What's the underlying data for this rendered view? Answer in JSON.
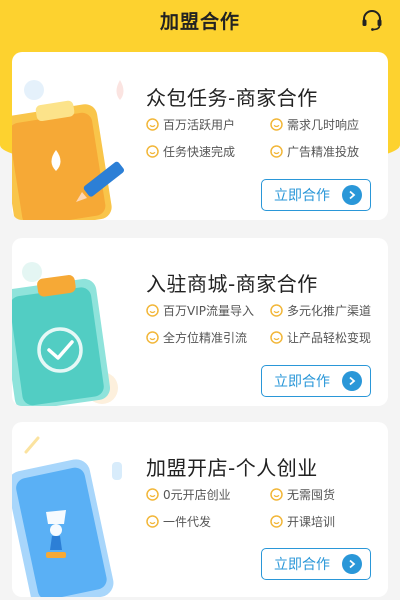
{
  "header": {
    "title": "加盟合作",
    "service_icon": "headset-icon",
    "bg_color": "#fdd22f"
  },
  "accent_color": "#2a97d8",
  "cards": [
    {
      "title": "众包任务-商家合作",
      "features": [
        "百万活跃用户",
        "需求几时响应",
        "任务快速完成",
        "广告精准投放"
      ],
      "cta": "立即合作",
      "illustration": "clipboard-drop-pencil-icon"
    },
    {
      "title": "入驻商城-商家合作",
      "features": [
        "百万VIP流量导入",
        "多元化推广渠道",
        "全方位精准引流",
        "让产品轻松变现"
      ],
      "cta": "立即合作",
      "illustration": "clipboard-check-icon"
    },
    {
      "title": "加盟开店-个人创业",
      "features": [
        "0元开店创业",
        "无需囤货",
        "一件代发",
        "开课培训"
      ],
      "cta": "立即合作",
      "illustration": "phone-figure-icon"
    }
  ]
}
